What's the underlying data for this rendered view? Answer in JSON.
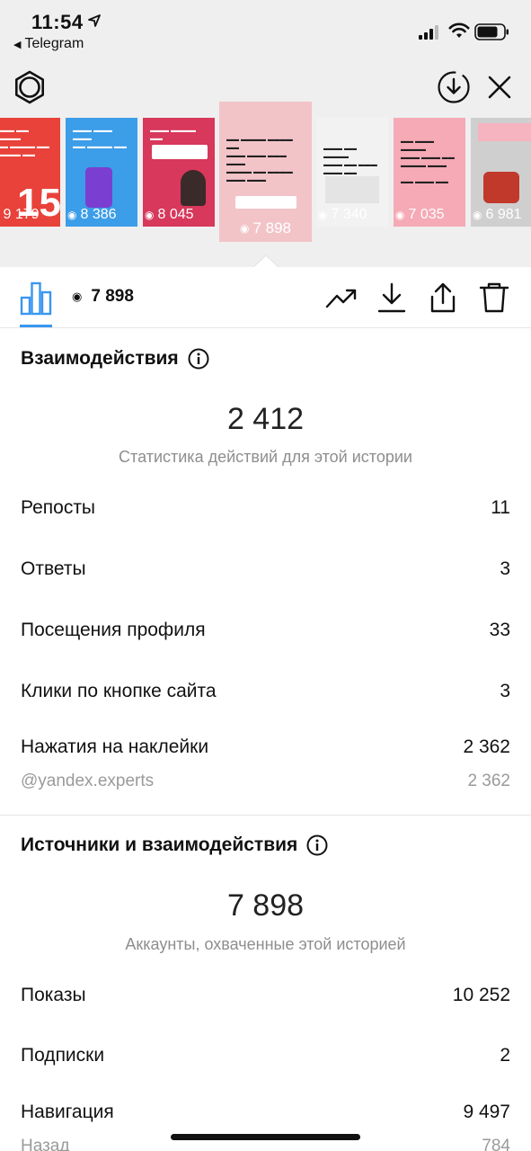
{
  "status_bar": {
    "time": "11:54",
    "back_app": "Telegram"
  },
  "thumbnails": [
    {
      "views": "9 179",
      "color": "#e8423a"
    },
    {
      "views": "8 386",
      "color": "#3c9de8"
    },
    {
      "views": "8 045",
      "color": "#d7385b"
    },
    {
      "views": "7 898",
      "color": "#f2c4c8",
      "active": true
    },
    {
      "views": "7 340",
      "color": "#f2f2f2"
    },
    {
      "views": "7 035",
      "color": "#f5aab5"
    },
    {
      "views": "6 981",
      "color": "#cfcfcf"
    }
  ],
  "toolbar": {
    "reach_value": "7 898"
  },
  "interactions": {
    "title": "Взаимодействия",
    "total": "2 412",
    "subtitle": "Статистика действий для этой истории",
    "rows": [
      {
        "label": "Репосты",
        "value": "11"
      },
      {
        "label": "Ответы",
        "value": "3"
      },
      {
        "label": "Посещения профиля",
        "value": "33"
      },
      {
        "label": "Клики по кнопке сайта",
        "value": "3"
      },
      {
        "label": "Нажатия на наклейки",
        "value": "2 362"
      }
    ],
    "sticker_row": {
      "label": "@yandex.experts",
      "value": "2 362"
    }
  },
  "sources": {
    "title": "Источники и взаимодействия",
    "total": "7 898",
    "subtitle": "Аккаунты, охваченные этой историей",
    "rows": [
      {
        "label": "Показы",
        "value": "10 252"
      },
      {
        "label": "Подписки",
        "value": "2"
      },
      {
        "label": "Навигация",
        "value": "9 497"
      }
    ],
    "sub_row": {
      "label": "Назад",
      "value": "784"
    }
  },
  "colors": {
    "accent": "#3897f0",
    "muted": "#8e8e8e"
  }
}
